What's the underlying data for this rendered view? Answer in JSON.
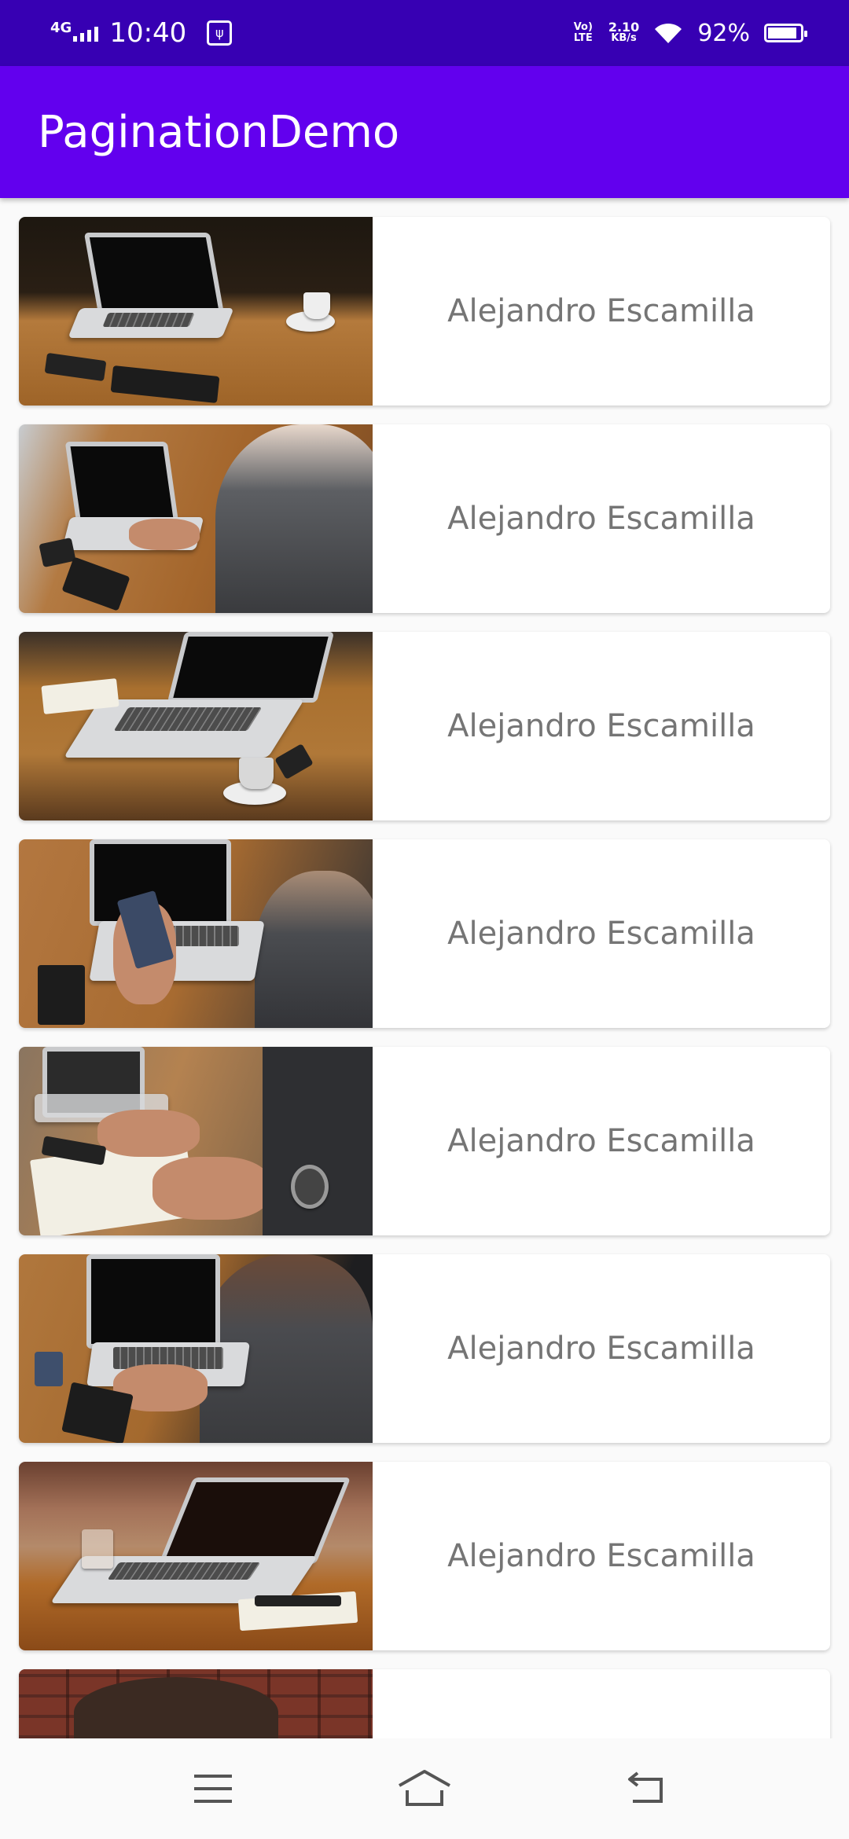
{
  "status_bar": {
    "network": "4G",
    "time": "10:40",
    "volte": "Vo) LTE",
    "speed_value": "2.10",
    "speed_unit": "KB/s",
    "battery_percent": "92%",
    "battery_level": 0.92
  },
  "app_bar": {
    "title": "PaginationDemo"
  },
  "items": [
    {
      "author": "Alejandro Escamilla"
    },
    {
      "author": "Alejandro Escamilla"
    },
    {
      "author": "Alejandro Escamilla"
    },
    {
      "author": "Alejandro Escamilla"
    },
    {
      "author": "Alejandro Escamilla"
    },
    {
      "author": "Alejandro Escamilla"
    },
    {
      "author": "Alejandro Escamilla"
    },
    {
      "author": ""
    }
  ],
  "nav_bar": {
    "icons": [
      "menu-icon",
      "home-icon",
      "back-icon"
    ]
  }
}
